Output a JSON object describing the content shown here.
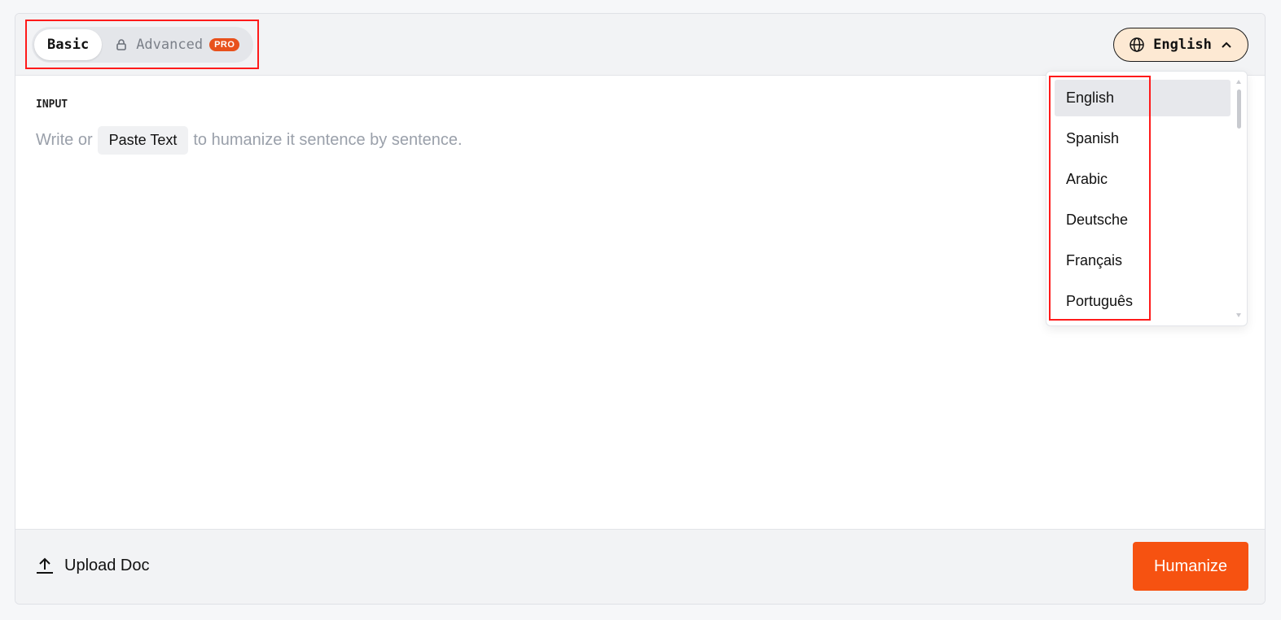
{
  "mode_tabs": {
    "basic_label": "Basic",
    "advanced_label": "Advanced",
    "pro_badge": "PRO"
  },
  "language": {
    "current": "English",
    "options": [
      "English",
      "Spanish",
      "Arabic",
      "Deutsche",
      "Français",
      "Português"
    ],
    "selected_index": 0
  },
  "input": {
    "label": "INPUT",
    "placeholder_before": "Write or",
    "paste_button": "Paste Text",
    "placeholder_after": "to humanize it sentence by sentence."
  },
  "footer": {
    "upload_label": "Upload Doc",
    "humanize_label": "Humanize"
  },
  "colors": {
    "accent": "#f65211",
    "pro_badge": "#e8511c",
    "language_button_bg": "#fde9d3",
    "annotation_box": "#ff1a1a"
  },
  "icons": {
    "advanced": "lock-icon",
    "language": "globe-icon",
    "language_toggle": "chevron-up-icon",
    "upload": "upload-icon"
  }
}
